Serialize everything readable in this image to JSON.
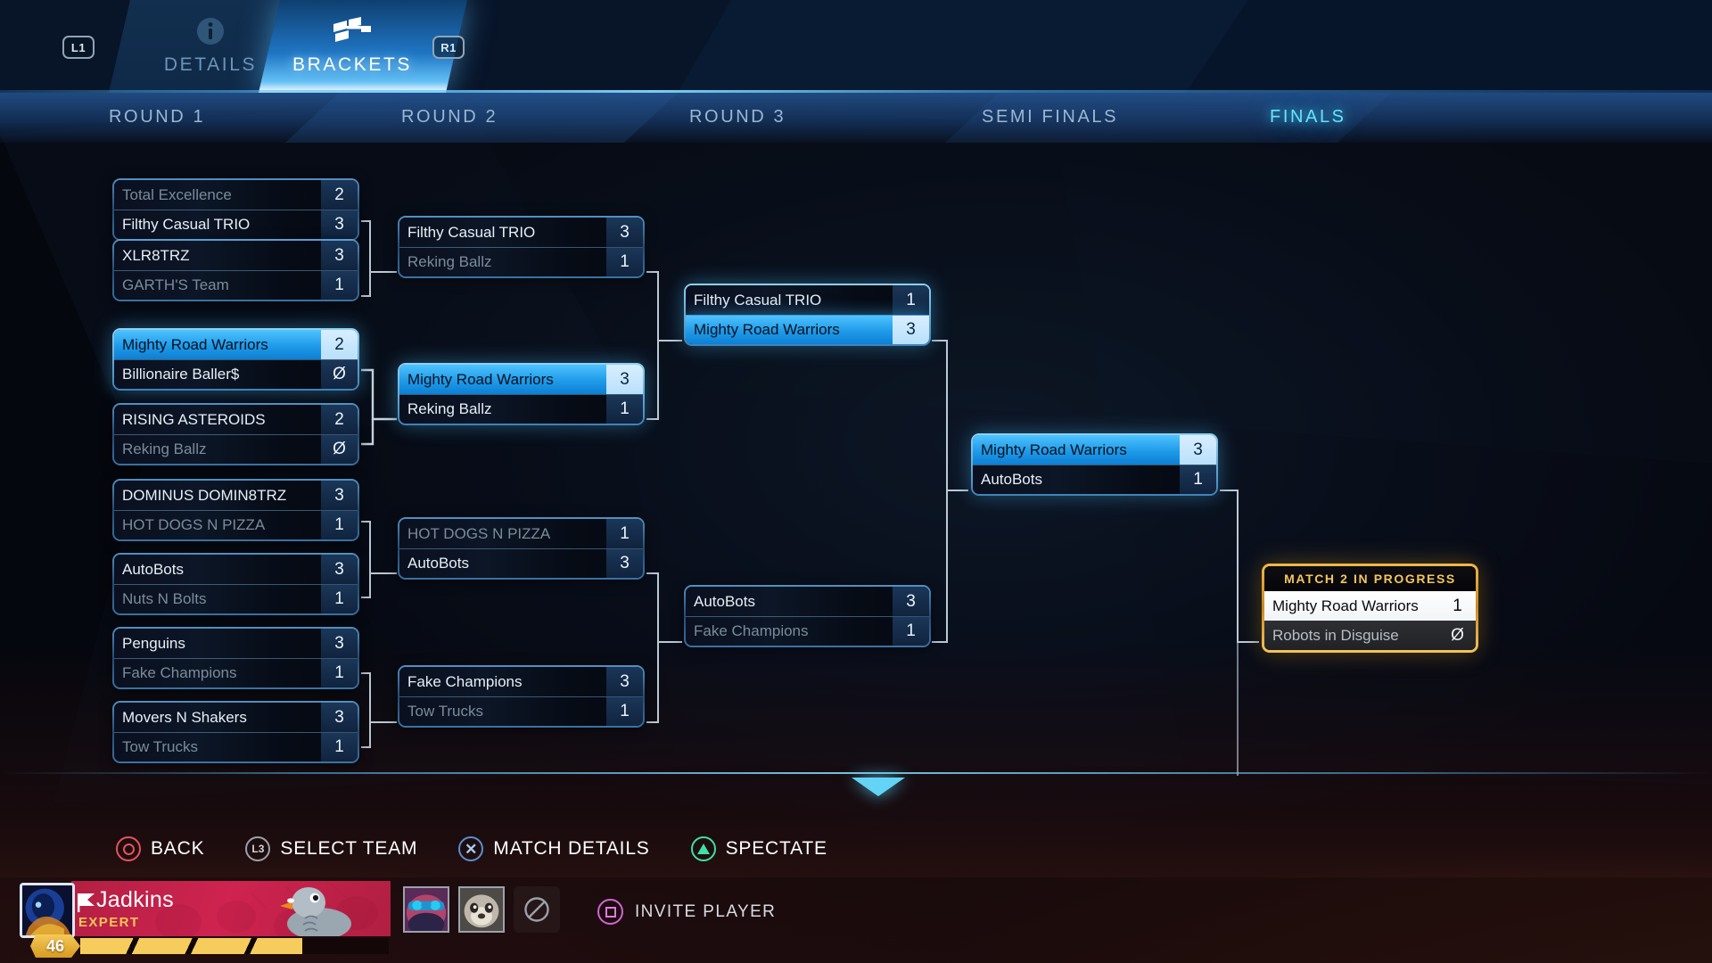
{
  "topbar": {
    "bumper_left": "L1",
    "bumper_right": "R1",
    "tabs": [
      {
        "label": "DETAILS",
        "icon": "info-icon",
        "active": false
      },
      {
        "label": "BRACKETS",
        "icon": "brackets-flag-icon",
        "active": true
      }
    ]
  },
  "rounds": [
    {
      "label": "ROUND 1",
      "active": false
    },
    {
      "label": "ROUND 2",
      "active": false
    },
    {
      "label": "ROUND 3",
      "active": false
    },
    {
      "label": "SEMI FINALS",
      "active": false
    },
    {
      "label": "FINALS",
      "active": true
    }
  ],
  "bracket": {
    "round1": [
      {
        "top": {
          "team": "Total Excellence",
          "score": "2",
          "winner": false
        },
        "bottom": {
          "team": "Filthy Casual TRIO",
          "score": "3",
          "winner": true
        }
      },
      {
        "top": {
          "team": "XLR8TRZ",
          "score": "3",
          "winner": true
        },
        "bottom": {
          "team": "GARTH'S Team",
          "score": "1",
          "winner": false
        }
      },
      {
        "top": {
          "team": "Mighty Road Warriors",
          "score": "2",
          "winner": true
        },
        "bottom": {
          "team": "Billionaire Baller$",
          "score": "Ø",
          "winner": false
        },
        "selected": true
      },
      {
        "top": {
          "team": "RISING ASTEROIDS",
          "score": "2",
          "winner": true
        },
        "bottom": {
          "team": "Reking Ballz",
          "score": "Ø",
          "winner": false
        }
      },
      {
        "top": {
          "team": "DOMINUS DOMIN8TRZ",
          "score": "3",
          "winner": true
        },
        "bottom": {
          "team": "HOT DOGS N PIZZA",
          "score": "1",
          "winner": false
        }
      },
      {
        "top": {
          "team": "AutoBots",
          "score": "3",
          "winner": true
        },
        "bottom": {
          "team": "Nuts N Bolts",
          "score": "1",
          "winner": false
        }
      },
      {
        "top": {
          "team": "Penguins",
          "score": "3",
          "winner": true
        },
        "bottom": {
          "team": "Fake Champions",
          "score": "1",
          "winner": false
        }
      },
      {
        "top": {
          "team": "Movers N Shakers",
          "score": "3",
          "winner": true
        },
        "bottom": {
          "team": "Tow Trucks",
          "score": "1",
          "winner": false
        }
      }
    ],
    "round2": [
      {
        "top": {
          "team": "Filthy Casual TRIO",
          "score": "3",
          "winner": true
        },
        "bottom": {
          "team": "Reking Ballz",
          "score": "1",
          "winner": false
        }
      },
      {
        "top": {
          "team": "Mighty Road Warriors",
          "score": "3",
          "winner": true,
          "highlight": true
        },
        "bottom": {
          "team": "Reking Ballz",
          "score": "1",
          "winner": true
        }
      },
      {
        "top": {
          "team": "HOT DOGS N PIZZA",
          "score": "1",
          "winner": false
        },
        "bottom": {
          "team": "AutoBots",
          "score": "3",
          "winner": true
        }
      },
      {
        "top": {
          "team": "Fake Champions",
          "score": "3",
          "winner": true
        },
        "bottom": {
          "team": "Tow Trucks",
          "score": "1",
          "winner": false
        }
      }
    ],
    "round3": [
      {
        "top": {
          "team": "Filthy Casual TRIO",
          "score": "1",
          "winner": true
        },
        "bottom": {
          "team": "Mighty Road Warriors",
          "score": "3",
          "winner": true,
          "highlight": true
        }
      },
      {
        "top": {
          "team": "AutoBots",
          "score": "3",
          "winner": true
        },
        "bottom": {
          "team": "Fake Champions",
          "score": "1",
          "winner": false
        }
      }
    ],
    "semifinals": [
      {
        "top": {
          "team": "Mighty Road Warriors",
          "score": "3",
          "winner": true,
          "highlight": true
        },
        "bottom": {
          "team": "AutoBots",
          "score": "1",
          "winner": true
        }
      }
    ],
    "finals": {
      "status": "MATCH 2 IN PROGRESS",
      "leader": {
        "team": "Mighty Road Warriors",
        "score": "1"
      },
      "trailer": {
        "team": "Robots in Disguise",
        "score": "Ø"
      }
    }
  },
  "actions": [
    {
      "glyph": "circle-button-icon",
      "label": "BACK"
    },
    {
      "glyph": "l3-stick-icon",
      "label": "SELECT TEAM"
    },
    {
      "glyph": "cross-button-icon",
      "label": "MATCH DETAILS"
    },
    {
      "glyph": "triangle-button-icon",
      "label": "SPECTATE"
    }
  ],
  "player": {
    "name": "Jadkins",
    "rank": "EXPERT",
    "level": "46",
    "xp_percent": 72,
    "invite_label": "INVITE PLAYER",
    "invite_glyph": "square-button-icon"
  },
  "colors": {
    "accent_cyan": "#63e4ff",
    "highlight_blue": "#1f9ae8",
    "finals_gold": "#f3c55e",
    "banner_red": "#cf2350"
  }
}
